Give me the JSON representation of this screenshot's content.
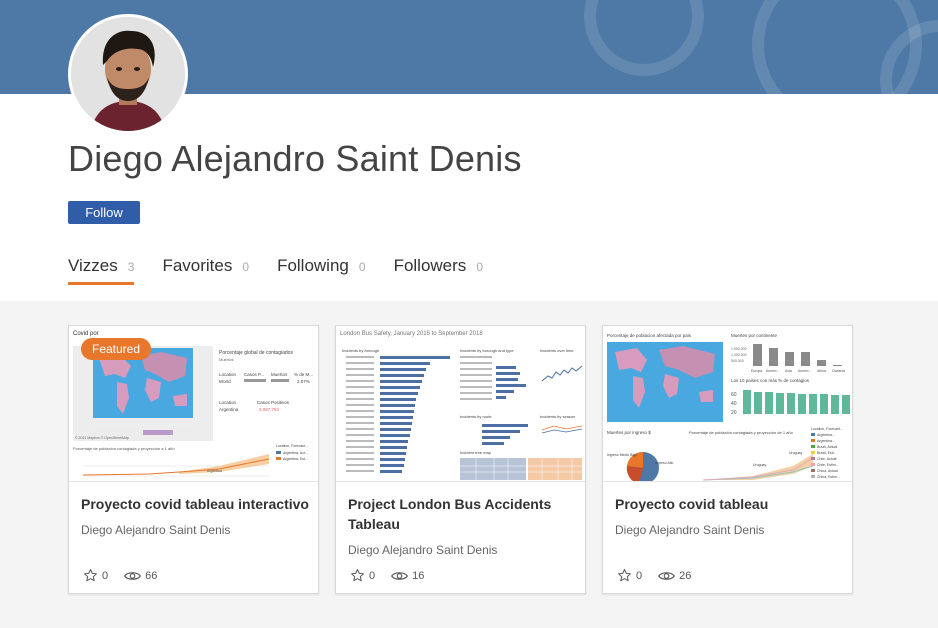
{
  "profile": {
    "name": "Diego Alejandro Saint Denis",
    "follow_label": "Follow"
  },
  "tabs": [
    {
      "label": "Vizzes",
      "count": "3",
      "active": true
    },
    {
      "label": "Favorites",
      "count": "0"
    },
    {
      "label": "Following",
      "count": "0"
    },
    {
      "label": "Followers",
      "count": "0"
    }
  ],
  "cards": [
    {
      "title": "Proyecto covid tableau interactivo",
      "author": "Diego Alejandro Saint Denis",
      "favorites": "0",
      "views": "66",
      "badge": "Featured",
      "thumb": {
        "header": "Covid por",
        "panel_title": "Porcentaje global de contagiados",
        "panel_sub": "Muertos",
        "col1": "Location",
        "col2": "Casos P...",
        "col3": "Muertos",
        "col4": "% de M...",
        "row_location": "World",
        "row_pct": "2.07%",
        "loc2": "Location",
        "loc2_val": "Argentina",
        "cases_label": "Casos Positivos",
        "cases_val": "5,097,763",
        "bottom_title": "Porcentaje de poblacion contagiada y proyeccion a 1 año",
        "legend_title": "Location, Forecast...",
        "legend_1": "Argentina, Act...",
        "legend_2": "Argentina, Est...",
        "line_label": "Argentina",
        "attrib": "© 2021 Mapbox © OpenStreetMap"
      }
    },
    {
      "title": "Project London Bus Accidents Tableau",
      "author": "Diego Alejandro Saint Denis",
      "favorites": "0",
      "views": "16",
      "thumb": {
        "title": "London Bus Safety, January 2015 to September 2018",
        "p1": "Incidents by borough",
        "p2": "Incidents by borough and type",
        "p3": "Incidents over time",
        "p4": "Incidents by route",
        "p5": "Incidents by season",
        "p6": "Incident tree map"
      }
    },
    {
      "title": "Proyecto covid tableau",
      "author": "Diego Alejandro Saint Denis",
      "favorites": "0",
      "views": "26",
      "thumb": {
        "map_title": "Porcentaje de poblacion afectada por pais",
        "bar_title": "Muertes por continente",
        "y1": "1,500,000",
        "y2": "1,000,000",
        "y3": "500,000",
        "cont": [
          "Europa",
          "Americ...",
          "Asia",
          "Americ...",
          "Africa",
          "Oceania"
        ],
        "top_title": "Los 10 paises con más % de contagios",
        "t1": "60",
        "t2": "40",
        "t3": "20",
        "pie_title": "Muertes por ingreso $",
        "pie_l1": "Ingreso Medio Bajo",
        "pie_l2": "Ingreso Alto",
        "proj_title": "Porcentaje de población contagiada y proyeccion de 1 año",
        "proj_l1": "Uruguay",
        "proj_l2": "Uruguay",
        "legend_title": "Location, Forecast...",
        "legend": [
          "Argentina...",
          "Argentina...",
          "Brazil, Actual",
          "Brazil, Esti...",
          "Chile, Actual",
          "Chile, Estim...",
          "China, Actual",
          "China, Estim..."
        ]
      }
    }
  ],
  "colors": {
    "banner": "#4e79a7",
    "follow": "#2f5da8",
    "accent": "#e8762b"
  },
  "icons": [
    "star-icon",
    "eye-icon"
  ]
}
